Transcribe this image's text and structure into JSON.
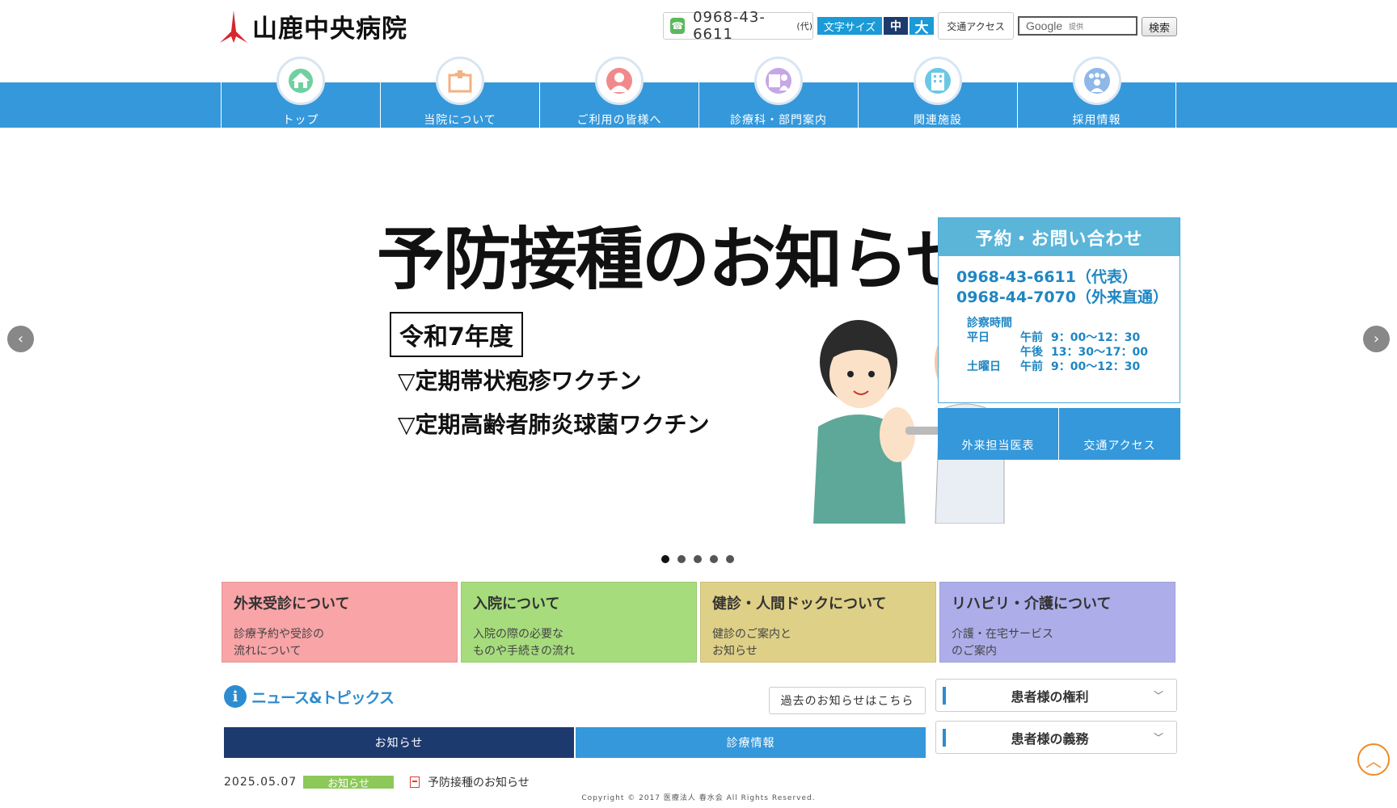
{
  "header": {
    "logo_text": "山鹿中央病院",
    "phone": "0968-43-6611",
    "phone_suffix": "(代)",
    "font_size_label": "文字サイズ",
    "font_size_mid": "中",
    "font_size_large": "大",
    "access_label": "交通アクセス",
    "search_placeholder": "Google",
    "search_provided": "提供",
    "search_button": "検索"
  },
  "nav": {
    "items": [
      {
        "label": "トップ",
        "icon": "home-icon"
      },
      {
        "label": "当院について",
        "icon": "hospital-icon"
      },
      {
        "label": "ご利用の皆様へ",
        "icon": "person-icon"
      },
      {
        "label": "診療科・部門案内",
        "icon": "doctor-icon"
      },
      {
        "label": "関連施設",
        "icon": "building-icon"
      },
      {
        "label": "採用情報",
        "icon": "group-icon"
      }
    ]
  },
  "hero": {
    "title": "予防接種のお知らせ",
    "year": "令和7年度",
    "line1": "▽定期帯状疱疹ワクチン",
    "line2": "▽定期高齢者肺炎球菌ワクチン",
    "slides": 5,
    "active_slide": 1
  },
  "contact": {
    "heading": "予約・お問い合わせ",
    "phone1": "0968-43-6611（代表）",
    "phone2": "0968-44-7070（外来直通）",
    "hours_title": "診察時間",
    "hours": [
      {
        "day": "平日",
        "period": "午前",
        "time": "9：00〜12：30"
      },
      {
        "day": "",
        "period": "午後",
        "time": "13：30〜17：00"
      },
      {
        "day": "土曜日",
        "period": "午前",
        "time": "9：00〜12：30"
      }
    ],
    "btn_doctors": "外来担当医表",
    "btn_access": "交通アクセス"
  },
  "cards": [
    {
      "title": "外来受診について",
      "desc1": "診療予約や受診の",
      "desc2": "流れについて"
    },
    {
      "title": "入院について",
      "desc1": "入院の際の必要な",
      "desc2": "ものや手続きの流れ"
    },
    {
      "title": "健診・人間ドックについて",
      "desc1": "健診のご案内と",
      "desc2": "お知らせ"
    },
    {
      "title": "リハビリ・介護について",
      "desc1": "介護・在宅サービス",
      "desc2": "のご案内"
    }
  ],
  "news": {
    "title": "ニュース&トピックス",
    "past_link": "過去のお知らせはこちら",
    "tab_notice": "お知らせ",
    "tab_medical": "診療情報",
    "items": [
      {
        "date": "2025.05.07",
        "category": "お知らせ",
        "title": "予防接種のお知らせ"
      }
    ]
  },
  "sidebar": {
    "rights": "患者様の権利",
    "duties": "患者様の義務"
  },
  "footer": {
    "copyright": "Copyright © 2017 医療法人 春水会 All Rights Reserved."
  },
  "colors": {
    "nav_blue": "#3498db",
    "navy": "#1d3a6e",
    "card_pink": "#f9a4a7",
    "card_green": "#a7dc7d",
    "card_yellow": "#ded087",
    "card_purple": "#adaee9"
  }
}
